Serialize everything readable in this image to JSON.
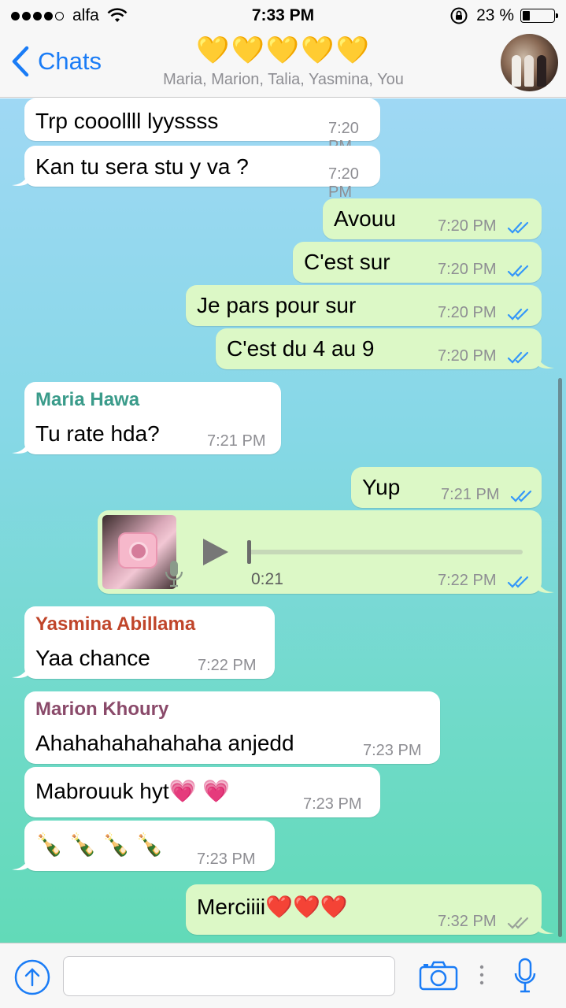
{
  "status_bar": {
    "carrier": "alfa",
    "time": "7:33 PM",
    "battery_percent": "23 %",
    "battery_level": 0.23,
    "signal_bars_filled": 4,
    "signal_bars_total": 5
  },
  "header": {
    "back_label": "Chats",
    "title": "💛💛💛💛💛",
    "participants": "Maria, Marion, Talia, Yasmina, You"
  },
  "messages": [
    {
      "direction": "in",
      "text": "Trp cooollll lyyssss",
      "time": "7:20 PM"
    },
    {
      "direction": "in",
      "text": "Kan tu sera stu y va ?",
      "time": "7:20 PM"
    },
    {
      "direction": "out",
      "text": "Avouu",
      "time": "7:20 PM",
      "status": "read"
    },
    {
      "direction": "out",
      "text": "C'est sur",
      "time": "7:20 PM",
      "status": "read"
    },
    {
      "direction": "out",
      "text": "Je pars pour sur",
      "time": "7:20 PM",
      "status": "read"
    },
    {
      "direction": "out",
      "text": "C'est du 4 au 9",
      "time": "7:20 PM",
      "status": "read"
    },
    {
      "direction": "in",
      "sender": "Maria Hawa",
      "sender_color": "#3a9b8a",
      "text": "Tu rate hda?",
      "time": "7:21 PM"
    },
    {
      "direction": "out",
      "text": "Yup",
      "time": "7:21 PM",
      "status": "read"
    },
    {
      "direction": "out",
      "type": "audio",
      "duration": "0:21",
      "time": "7:22 PM",
      "status": "read"
    },
    {
      "direction": "in",
      "sender": "Yasmina Abillama",
      "sender_color": "#c0452a",
      "text": "Yaa chance",
      "time": "7:22 PM"
    },
    {
      "direction": "in",
      "sender": "Marion Khoury",
      "sender_color": "#8a4a6a",
      "text": "Ahahahahahahaha anjedd",
      "time": "7:23 PM"
    },
    {
      "direction": "in",
      "text": "Mabrouuk hyt💗 💗",
      "time": "7:23 PM"
    },
    {
      "direction": "in",
      "text": "🍾 🍾 🍾 🍾",
      "time": "7:23 PM"
    },
    {
      "direction": "out",
      "text": "Merciiii❤️❤️❤️",
      "time": "7:32 PM",
      "status": "delivered"
    }
  ],
  "input_bar": {
    "placeholder": "",
    "icons": [
      "upload-icon",
      "camera-icon",
      "more-icon",
      "microphone-icon"
    ]
  },
  "colors": {
    "accent": "#1a7cf6",
    "bubble_out": "#dcf8c6",
    "bubble_in": "#ffffff",
    "read_tick": "#3497f9",
    "delivered_tick": "#9aa39a"
  }
}
